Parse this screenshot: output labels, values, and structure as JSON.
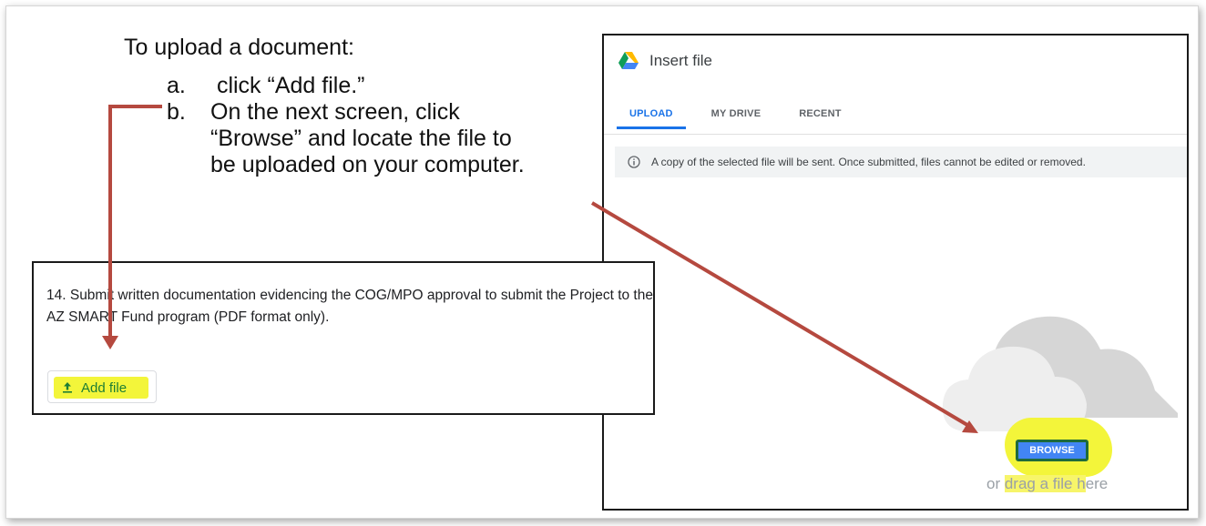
{
  "instructions": {
    "heading": "To upload a document:",
    "steps": [
      {
        "marker": "a.",
        "text": " click “Add file.”"
      },
      {
        "marker": "b.",
        "text": "On the next screen, click\n“Browse” and locate the file to\nbe uploaded on your computer."
      }
    ]
  },
  "dialog": {
    "title": "Insert file",
    "tabs": [
      "UPLOAD",
      "MY DRIVE",
      "RECENT"
    ],
    "active_tab": "UPLOAD",
    "notice": "A copy of the selected file will be sent. Once submitted, files cannot be edited or removed.",
    "browse_label": "BROWSE",
    "drag_text_prefix": "or ",
    "drag_text_highlight": "drag a file h",
    "drag_text_suffix": "ere"
  },
  "question": {
    "text": "14. Submit written documentation evidencing the COG/MPO approval to submit the Project to the AZ SMART Fund program (PDF format only).",
    "add_file_label": "Add file"
  },
  "colors": {
    "arrow": "#b5493f",
    "highlight": "#f3f53a",
    "drive_blue": "#1a73e8",
    "add_file_green": "#1e7e34"
  },
  "icons": {
    "drive": "google-drive-icon",
    "info": "info-icon",
    "upload": "upload-icon",
    "cloud": "cloud-illustration"
  }
}
